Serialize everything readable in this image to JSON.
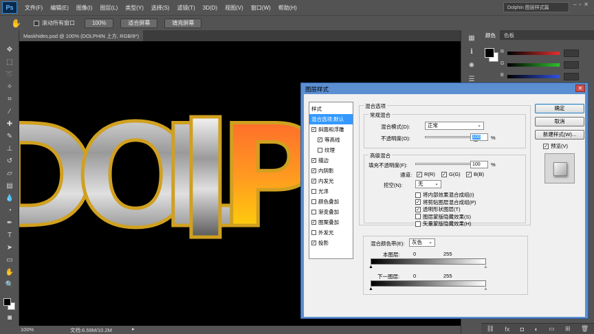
{
  "app": {
    "logo": "Ps",
    "workspace": "Dolphin 图层样式篇"
  },
  "menu": [
    "文件(F)",
    "编辑(E)",
    "图像(I)",
    "图层(L)",
    "类型(Y)",
    "选择(S)",
    "滤镜(T)",
    "3D(D)",
    "视图(V)",
    "窗口(W)",
    "帮助(H)"
  ],
  "options": {
    "scroll_all": "滚动所有窗口",
    "zoom_100": "100%",
    "fit_screen": "适合屏幕",
    "fill_screen": "填充屏幕"
  },
  "document": {
    "tab": "Maskhides.psd @ 100% (DOLPHIN 上方, RGB/8*)",
    "canvas_text": "DOLPHIN"
  },
  "status": {
    "zoom": "100%",
    "doc_size": "文档:6.59M/10.2M"
  },
  "panel": {
    "tabs": [
      "颜色",
      "色板"
    ],
    "sliders": [
      {
        "label": "R",
        "color": "#e03030"
      },
      {
        "label": "G",
        "color": "#30c030"
      },
      {
        "label": "B",
        "color": "#3050e0"
      }
    ]
  },
  "dialog": {
    "title": "图层样式",
    "close": "✕",
    "styles_header": "样式",
    "style_items": [
      {
        "label": "混合选项:默认",
        "checkbox": false,
        "checked": false,
        "selected": true,
        "indent": false
      },
      {
        "label": "斜面和浮雕",
        "checkbox": true,
        "checked": true,
        "selected": false,
        "indent": false
      },
      {
        "label": "等高线",
        "checkbox": true,
        "checked": true,
        "selected": false,
        "indent": true
      },
      {
        "label": "纹理",
        "checkbox": true,
        "checked": false,
        "selected": false,
        "indent": true
      },
      {
        "label": "描边",
        "checkbox": true,
        "checked": true,
        "selected": false,
        "indent": false
      },
      {
        "label": "内阴影",
        "checkbox": true,
        "checked": true,
        "selected": false,
        "indent": false
      },
      {
        "label": "内发光",
        "checkbox": true,
        "checked": true,
        "selected": false,
        "indent": false
      },
      {
        "label": "光泽",
        "checkbox": true,
        "checked": false,
        "selected": false,
        "indent": false
      },
      {
        "label": "颜色叠加",
        "checkbox": true,
        "checked": false,
        "selected": false,
        "indent": false
      },
      {
        "label": "渐变叠加",
        "checkbox": true,
        "checked": false,
        "selected": false,
        "indent": false
      },
      {
        "label": "图案叠加",
        "checkbox": true,
        "checked": true,
        "selected": false,
        "indent": false
      },
      {
        "label": "外发光",
        "checkbox": true,
        "checked": false,
        "selected": false,
        "indent": false
      },
      {
        "label": "投影",
        "checkbox": true,
        "checked": true,
        "selected": false,
        "indent": false
      }
    ],
    "blend_options": "混合选项",
    "general_blending": "常规混合",
    "blend_mode_label": "混合模式(D):",
    "blend_mode_value": "正常",
    "opacity_label": "不透明度(O):",
    "opacity_value": "100",
    "percent": "%",
    "advanced_blending": "高级混合",
    "fill_opacity_label": "填充不透明度(F):",
    "fill_opacity_value": "100",
    "channels_label": "通道:",
    "channels": [
      "R(R)",
      "G(G)",
      "B(B)"
    ],
    "knockout_label": "挖空(N):",
    "knockout_value": "无",
    "adv_options": [
      {
        "label": "将内部效果混合成组(I)",
        "checked": false
      },
      {
        "label": "将剪贴图层混合成组(P)",
        "checked": true
      },
      {
        "label": "透明形状图层(T)",
        "checked": true
      },
      {
        "label": "图层蒙版隐藏效果(S)",
        "checked": false
      },
      {
        "label": "矢量蒙版隐藏效果(H)",
        "checked": false
      }
    ],
    "blend_if_label": "混合颜色带(E):",
    "blend_if_value": "灰色",
    "this_layer_label": "本图层:",
    "underlying_label": "下一图层:",
    "range_min": "0",
    "range_max": "255",
    "buttons": {
      "ok": "确定",
      "cancel": "取消",
      "new_style": "新建样式(W)...",
      "preview": "预览(V)"
    }
  }
}
